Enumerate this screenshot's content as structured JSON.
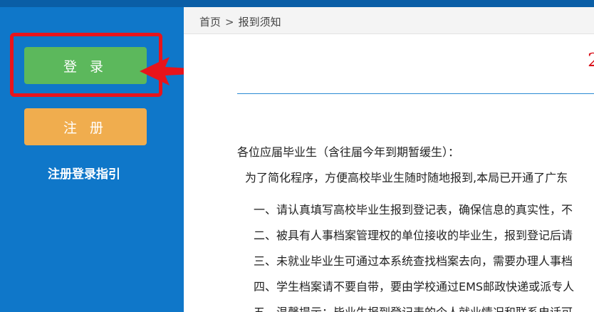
{
  "sidebar": {
    "login_label": "登 录",
    "register_label": "注 册",
    "guide_label": "注册登录指引"
  },
  "breadcrumb": {
    "home": "首页",
    "separator": ">",
    "current": "报到须知"
  },
  "notice": {
    "title_visible": "2",
    "greeting": "各位应届毕业生（含往届今年到期暂缓生）：",
    "intro": "为了简化程序，方便高校毕业生随时随地报到,本局已开通了广东",
    "items": [
      "一、请认真填写高校毕业生报到登记表，确保信息的真实性，不",
      "二、被具有人事档案管理权的单位接收的毕业生，报到登记后请",
      "三、未就业毕业生可通过本系统查找档案去向，需要办理人事档",
      "四、学生档案请不要自带，要由学校通过EMS邮政快递或派专人",
      "五、温馨提示：毕业生报到登记表的个人就业情况和联系电话可"
    ]
  },
  "colors": {
    "sidebar": "#0f77c9",
    "login_button": "#5cb85c",
    "register_button": "#f0ad4e",
    "annotation_red": "#e8141b",
    "title_red": "#d9111a",
    "divider": "#2a8ad4"
  },
  "icons": {
    "annotation_arrow": "left-arrow-icon"
  }
}
